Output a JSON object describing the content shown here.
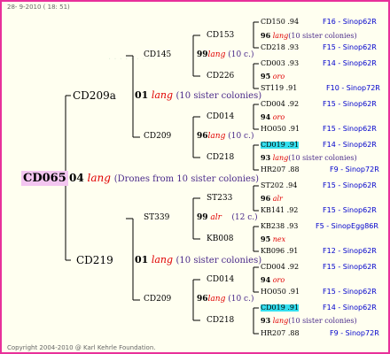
{
  "header": "28- 9-2010 ( 18: 51)",
  "footer": "Copyright 2004-2010 @ Karl Kehrle Foundation.",
  "root": "CD065",
  "gen1": {
    "num": "04",
    "race": "lang",
    "note": "(Drones from 10 sister colonies)"
  },
  "mother_top": "CD209a",
  "mother_bottom": "CD219",
  "node_01_top": {
    "num": "01",
    "race": "lang",
    "note": "(10 sister colonies)"
  },
  "node_01_bottom": {
    "num": "01",
    "race": "lang",
    "note": "(10 sister colonies)"
  },
  "gm_top_a": "CD145",
  "gm_top_b": "CD209",
  "gm_bot_a": "ST339",
  "gm_bot_b": "CD209",
  "node_99a": {
    "num": "99",
    "race": "lang",
    "note": "(10 c.)"
  },
  "node_96a": {
    "num": "96",
    "race": "lang",
    "note": "(10 c.)"
  },
  "node_99b": {
    "num": "99",
    "race": "alr",
    "note": "(12 c.)"
  },
  "node_96b": {
    "num": "96",
    "race": "lang",
    "note": "(10 c.)"
  },
  "l3": [
    "CD153",
    "CD226",
    "CD014",
    "CD218",
    "ST233",
    "KB008",
    "CD014",
    "CD218"
  ],
  "rows": [
    {
      "name": "CD150 .94",
      "ped": "F16 - Sinop62R"
    },
    {
      "name": "CD218 .93",
      "ped": "F15 - Sinop62R"
    },
    {
      "name": "CD003 .93",
      "ped": "F14 - Sinop62R"
    },
    {
      "name": "ST119 .91",
      "ped": "F10 - Sinop72R"
    },
    {
      "name": "CD004 .92",
      "ped": "F15 - Sinop62R"
    },
    {
      "name": "HO050 .91",
      "ped": "F15 - Sinop62R"
    },
    {
      "name": "CD019 .91",
      "ped": "F14 - Sinop62R"
    },
    {
      "name": "HR207 .88",
      "ped": "F9 - Sinop72R"
    },
    {
      "name": "ST202 .94",
      "ped": "F15 - Sinop62R"
    },
    {
      "name": "KB141 .92",
      "ped": "F15 - Sinop62R"
    },
    {
      "name": "KB238 .93",
      "ped": "F5 - SinopEgg86R"
    },
    {
      "name": "KB096 .91",
      "ped": "F12 - Sinop62R"
    },
    {
      "name": "CD004 .92",
      "ped": "F15 - Sinop62R"
    },
    {
      "name": "HO050 .91",
      "ped": "F15 - Sinop62R"
    },
    {
      "name": "CD019 .91",
      "ped": "F14 - Sinop62R"
    },
    {
      "name": "HR207 .88",
      "ped": "F9 - Sinop72R"
    }
  ],
  "mid": [
    {
      "num": "96",
      "race": "lang",
      "note": "(10 sister colonies)"
    },
    {
      "num": "95",
      "race": "oro",
      "note": ""
    },
    {
      "num": "94",
      "race": "oro",
      "note": ""
    },
    {
      "num": "93",
      "race": "lang",
      "note": "(10 sister colonies)"
    },
    {
      "num": "96",
      "race": "alr",
      "note": ""
    },
    {
      "num": "95",
      "race": "nex",
      "note": ""
    },
    {
      "num": "94",
      "race": "oro",
      "note": ""
    },
    {
      "num": "93",
      "race": "lang",
      "note": "(10 sister colonies)"
    }
  ]
}
